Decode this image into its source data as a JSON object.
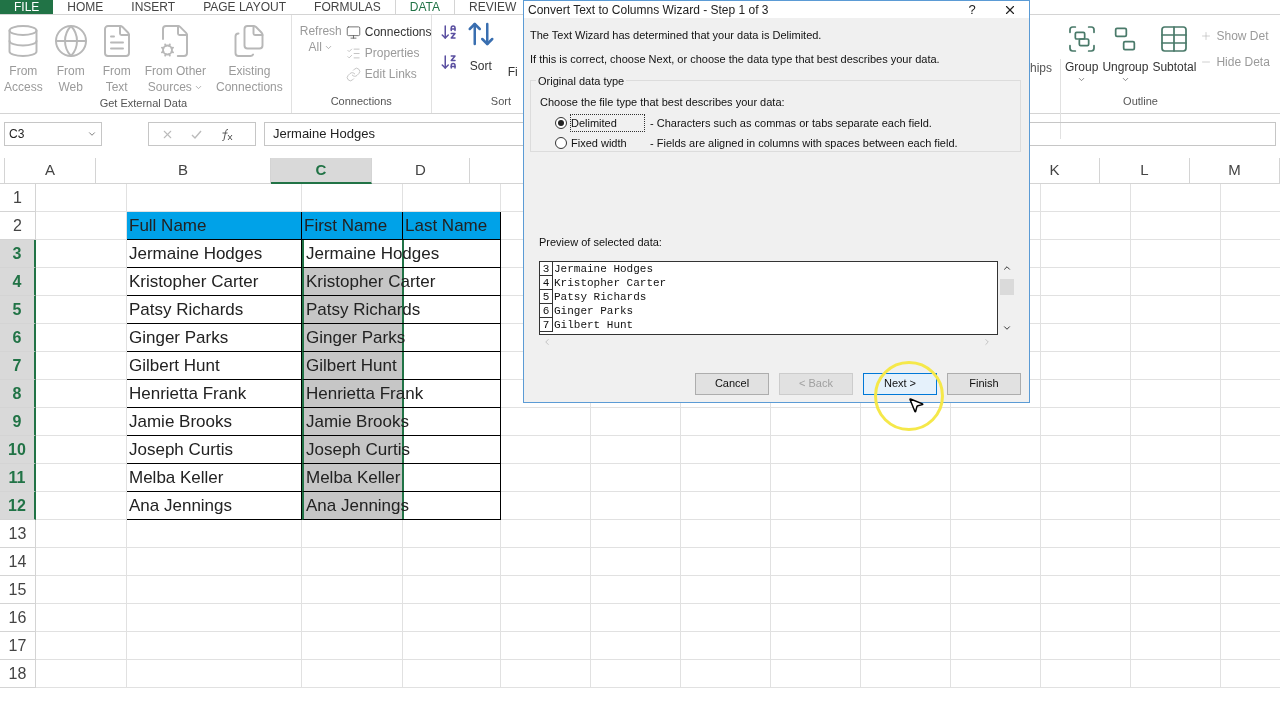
{
  "ribbon": {
    "tabs": [
      {
        "label": "FILE",
        "kind": "file",
        "selected": false
      },
      {
        "label": "HOME",
        "kind": "tab",
        "selected": false
      },
      {
        "label": "INSERT",
        "kind": "tab",
        "selected": false
      },
      {
        "label": "PAGE LAYOUT",
        "kind": "tab",
        "selected": false
      },
      {
        "label": "FORMULAS",
        "kind": "tab",
        "selected": false
      },
      {
        "label": "DATA",
        "kind": "tab",
        "selected": true
      },
      {
        "label": "REVIEW",
        "kind": "tab",
        "selected": false
      }
    ],
    "external": {
      "label": "Get External Data",
      "items": [
        {
          "kind": "access",
          "lines": [
            "From",
            "Access"
          ],
          "disabled": true,
          "dropdown": false
        },
        {
          "kind": "web",
          "lines": [
            "From",
            "Web"
          ],
          "disabled": true,
          "dropdown": false
        },
        {
          "kind": "text",
          "lines": [
            "From",
            "Text"
          ],
          "disabled": true,
          "dropdown": false
        },
        {
          "kind": "other",
          "lines": [
            "From Other",
            "Sources"
          ],
          "disabled": true,
          "dropdown": true
        },
        {
          "kind": "existing",
          "lines": [
            "Existing",
            "Connections"
          ],
          "disabled": true,
          "dropdown": false
        }
      ]
    },
    "connections": {
      "label": "Connections",
      "refresh": {
        "lines": [
          "Refresh",
          "All"
        ],
        "disabled": true,
        "dropdown": true
      },
      "items": [
        {
          "kind": "connections",
          "label": "Connections",
          "disabled": false
        },
        {
          "kind": "properties",
          "label": "Properties",
          "disabled": true
        },
        {
          "kind": "links",
          "label": "Edit Links",
          "disabled": true
        }
      ]
    },
    "sort": {
      "label": "Sort",
      "sort_button": "Sort",
      "filter_button": "Fi"
    },
    "relationships_button": "hips",
    "outline": {
      "label": "Outline",
      "items": [
        {
          "kind": "group",
          "label": "Group",
          "dropdown": true
        },
        {
          "kind": "ungroup",
          "label": "Ungroup",
          "dropdown": true
        },
        {
          "kind": "subtotal",
          "label": "Subtotal",
          "dropdown": false
        }
      ],
      "detail_items": [
        {
          "kind": "show",
          "label": "Show Det",
          "disabled": true
        },
        {
          "kind": "hide",
          "label": "Hide Deta",
          "disabled": true
        }
      ]
    }
  },
  "formula_bar": {
    "name_box": "C3",
    "value": "Jermaine Hodges"
  },
  "sheet": {
    "columns": [
      {
        "label": "A",
        "selected": false
      },
      {
        "label": "B",
        "selected": false
      },
      {
        "label": "C",
        "selected": true
      },
      {
        "label": "D",
        "selected": false
      },
      {
        "label": "K",
        "selected": false
      },
      {
        "label": "L",
        "selected": false
      },
      {
        "label": "M",
        "selected": false
      }
    ],
    "rows": [
      {
        "number": "1",
        "kind": "empty",
        "selected": false
      },
      {
        "number": "2",
        "kind": "header",
        "selected": false,
        "full_name": "Full Name",
        "first_name": "First Name",
        "last_name": "Last Name"
      },
      {
        "number": "3",
        "kind": "data",
        "selected": true,
        "active": true,
        "full_name": "Jermaine Hodges",
        "first_name": "Jermaine Hodges"
      },
      {
        "number": "4",
        "kind": "data",
        "selected": true,
        "active": false,
        "full_name": "Kristopher Carter",
        "first_name": "Kristopher Carter"
      },
      {
        "number": "5",
        "kind": "data",
        "selected": true,
        "active": false,
        "full_name": "Patsy Richards",
        "first_name": "Patsy Richards"
      },
      {
        "number": "6",
        "kind": "data",
        "selected": true,
        "active": false,
        "full_name": "Ginger Parks",
        "first_name": "Ginger Parks"
      },
      {
        "number": "7",
        "kind": "data",
        "selected": true,
        "active": false,
        "full_name": "Gilbert Hunt",
        "first_name": "Gilbert Hunt"
      },
      {
        "number": "8",
        "kind": "data",
        "selected": true,
        "active": false,
        "full_name": "Henrietta Frank",
        "first_name": "Henrietta Frank"
      },
      {
        "number": "9",
        "kind": "data",
        "selected": true,
        "active": false,
        "full_name": "Jamie Brooks",
        "first_name": "Jamie Brooks"
      },
      {
        "number": "10",
        "kind": "data",
        "selected": true,
        "active": false,
        "full_name": "Joseph Curtis",
        "first_name": "Joseph Curtis"
      },
      {
        "number": "11",
        "kind": "data",
        "selected": true,
        "active": false,
        "full_name": "Melba Keller",
        "first_name": "Melba Keller"
      },
      {
        "number": "12",
        "kind": "data",
        "selected": true,
        "active": false,
        "full_name": "Ana Jennings",
        "first_name": "Ana Jennings"
      },
      {
        "number": "13",
        "kind": "empty",
        "selected": false
      },
      {
        "number": "14",
        "kind": "empty",
        "selected": false
      },
      {
        "number": "15",
        "kind": "empty",
        "selected": false
      },
      {
        "number": "16",
        "kind": "empty",
        "selected": false
      },
      {
        "number": "17",
        "kind": "empty",
        "selected": false
      },
      {
        "number": "18",
        "kind": "empty",
        "selected": false
      }
    ]
  },
  "dialog": {
    "title": "Convert Text to Columns Wizard - Step 1 of 3",
    "help": "?",
    "intro": [
      "The Text Wizard has determined that your data is Delimited.",
      "If this is correct, choose Next, or choose the data type that best describes your data."
    ],
    "group_label": "Original data type",
    "prompt": "Choose the file type that best describes your data:",
    "options": [
      {
        "label": "Delimited",
        "description": "- Characters such as commas or tabs separate each field.",
        "selected": true
      },
      {
        "label": "Fixed width",
        "description": "- Fields are aligned in columns with spaces between each field.",
        "selected": false
      }
    ],
    "preview_label": "Preview of selected data:",
    "preview_rows": [
      {
        "number": "3",
        "text": "Jermaine Hodges"
      },
      {
        "number": "4",
        "text": "Kristopher Carter"
      },
      {
        "number": "5",
        "text": "Patsy Richards"
      },
      {
        "number": "6",
        "text": "Ginger Parks"
      },
      {
        "number": "7",
        "text": "Gilbert Hunt"
      }
    ],
    "buttons": [
      {
        "label": "Cancel",
        "disabled": false,
        "default": false
      },
      {
        "label": "< Back",
        "disabled": true,
        "default": false
      },
      {
        "label": "Next >",
        "disabled": false,
        "default": true
      },
      {
        "label": "Finish",
        "disabled": false,
        "default": false
      }
    ]
  }
}
